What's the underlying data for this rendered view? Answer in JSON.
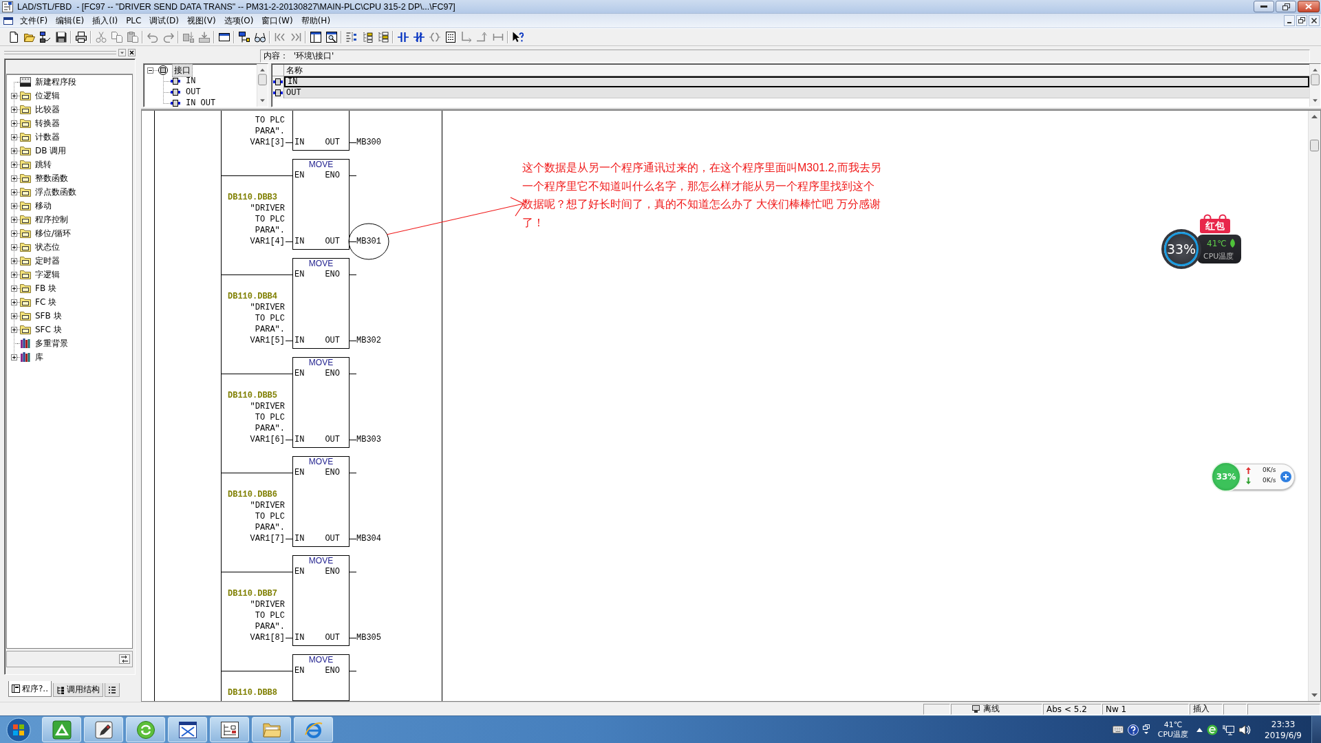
{
  "window": {
    "title": "LAD/STL/FBD  - [FC97 -- \"DRIVER SEND DATA TRANS\" -- PM31-2-20130827\\MAIN-PLC\\CPU 315-2 DP\\...\\FC97]"
  },
  "menu": [
    "文件(F)",
    "编辑(E)",
    "插入(I)",
    "PLC",
    "调试(D)",
    "视图(V)",
    "选项(O)",
    "窗口(W)",
    "帮助(H)"
  ],
  "toolbar": {
    "groups": [
      {
        "buttons": [
          {
            "disabled": false
          },
          {
            "disabled": false
          },
          {
            "disabled": false
          },
          {
            "disabled": false
          }
        ]
      },
      {
        "buttons": [
          {
            "disabled": false
          }
        ]
      },
      {
        "buttons": [
          {
            "disabled": true
          },
          {
            "disabled": true
          },
          {
            "disabled": true
          }
        ]
      },
      {
        "buttons": [
          {
            "disabled": true
          },
          {
            "disabled": true
          }
        ]
      },
      {
        "buttons": [
          {
            "disabled": true
          },
          {
            "disabled": true
          }
        ]
      },
      {
        "buttons": [
          {
            "disabled": false
          }
        ]
      },
      {
        "buttons": [
          {
            "disabled": false
          },
          {
            "disabled": false
          }
        ]
      },
      {
        "buttons": [
          {
            "disabled": true
          },
          {
            "disabled": true
          }
        ]
      },
      {
        "buttons": [
          {
            "disabled": false
          },
          {
            "disabled": false
          }
        ]
      },
      {
        "buttons": [
          {
            "disabled": false
          },
          {
            "disabled": false
          },
          {
            "disabled": false
          }
        ]
      },
      {
        "buttons": [
          {
            "disabled": false
          },
          {
            "disabled": false
          },
          {
            "disabled": true
          },
          {
            "disabled": false
          },
          {
            "disabled": true
          },
          {
            "disabled": true
          },
          {
            "disabled": true
          }
        ]
      },
      {
        "buttons": [
          {
            "disabled": false
          }
        ]
      }
    ]
  },
  "catalog": {
    "items": [
      {
        "label": "新建程序段"
      },
      {
        "label": "位逻辑",
        "expanded": false
      },
      {
        "label": "比较器",
        "expanded": false
      },
      {
        "label": "转换器",
        "expanded": false
      },
      {
        "label": "计数器",
        "expanded": false
      },
      {
        "label": "DB 调用",
        "expanded": false
      },
      {
        "label": "跳转",
        "expanded": false
      },
      {
        "label": "整数函数",
        "expanded": false
      },
      {
        "label": "浮点数函数",
        "expanded": false
      },
      {
        "label": "移动",
        "expanded": false
      },
      {
        "label": "程序控制",
        "expanded": false
      },
      {
        "label": "移位/循环",
        "expanded": false
      },
      {
        "label": "状态位",
        "expanded": false
      },
      {
        "label": "定时器",
        "expanded": false
      },
      {
        "label": "字逻辑",
        "expanded": false
      },
      {
        "label": "FB 块",
        "expanded": false
      },
      {
        "label": "FC 块",
        "expanded": false
      },
      {
        "label": "SFB 块",
        "expanded": false
      },
      {
        "label": "SFC 块",
        "expanded": false
      },
      {
        "label": "多重背景"
      },
      {
        "label": "库",
        "expanded": false
      }
    ],
    "tabs": [
      {
        "label": "程序?..",
        "selected": true
      },
      {
        "label": "调用结构",
        "selected": false
      },
      {
        "selected": false
      }
    ]
  },
  "interface": {
    "content_label": "内容：  '环境\\接口'",
    "tree": {
      "label": "接口",
      "expanded": true,
      "selected": true,
      "children": [
        {
          "label": "IN",
          "selected": false
        },
        {
          "label": "OUT",
          "selected": false
        },
        {
          "label": "IN OUT",
          "selected": false
        }
      ]
    },
    "table": {
      "columns": [
        "名称"
      ],
      "rows": [
        {
          "name": "IN",
          "selected": true
        },
        {
          "name": "OUT",
          "selected": false
        }
      ]
    }
  },
  "ladder": {
    "rungs": [
      {
        "operand": [
          "TO PLC",
          "PARA″.",
          "VAR1[3]"
        ],
        "in_pin": "IN",
        "out_pin": "OUT",
        "output": "MB300",
        "circled": false
      },
      {
        "title": "MOVE",
        "en_pin": "EN",
        "eno_pin": "ENO",
        "address": "DB110.DBB3",
        "operand": [
          "″DRIVER",
          "TO PLC",
          "PARA″.",
          "VAR1[4]"
        ],
        "in_pin": "IN",
        "out_pin": "OUT",
        "output": "MB301",
        "circled": true
      },
      {
        "title": "MOVE",
        "en_pin": "EN",
        "eno_pin": "ENO",
        "address": "DB110.DBB4",
        "operand": [
          "″DRIVER",
          "TO PLC",
          "PARA″.",
          "VAR1[5]"
        ],
        "in_pin": "IN",
        "out_pin": "OUT",
        "output": "MB302",
        "circled": false
      },
      {
        "title": "MOVE",
        "en_pin": "EN",
        "eno_pin": "ENO",
        "address": "DB110.DBB5",
        "operand": [
          "″DRIVER",
          "TO PLC",
          "PARA″.",
          "VAR1[6]"
        ],
        "in_pin": "IN",
        "out_pin": "OUT",
        "output": "MB303",
        "circled": false
      },
      {
        "title": "MOVE",
        "en_pin": "EN",
        "eno_pin": "ENO",
        "address": "DB110.DBB6",
        "operand": [
          "″DRIVER",
          "TO PLC",
          "PARA″.",
          "VAR1[7]"
        ],
        "in_pin": "IN",
        "out_pin": "OUT",
        "output": "MB304",
        "circled": false
      },
      {
        "title": "MOVE",
        "en_pin": "EN",
        "eno_pin": "ENO",
        "address": "DB110.DBB7",
        "operand": [
          "″DRIVER",
          "TO PLC",
          "PARA″.",
          "VAR1[8]"
        ],
        "in_pin": "IN",
        "out_pin": "OUT",
        "output": "MB305",
        "circled": false
      },
      {
        "title": "MOVE",
        "en_pin": "EN",
        "eno_pin": "ENO",
        "address": "DB110.DBB8",
        "circled": false
      }
    ],
    "note": "这个数据是从另一个程序通讯过来的，在这个程序里面叫M301.2,而我去另一个程序里它不知道叫什么名字，那怎么样才能从另一个程序里找到这个数据呢？想了好长时间了，真的不知道怎么办了 大侠们棒棒忙吧 万分感谢了！"
  },
  "status_bar": {
    "mode": "离线",
    "address": "Abs < 5.2",
    "network": "Nw 1",
    "edit_mode": "插入"
  },
  "cpu_monitor": {
    "badge": "红包",
    "load": "33%",
    "temperature": "41℃",
    "label": "CPU温度"
  },
  "net_monitor": {
    "load": "33%",
    "upload": "0K/s",
    "download": "0K/s"
  },
  "taskbar": {
    "temperature": "41℃",
    "sensor": "CPU温度",
    "time": "23:33",
    "date": "2019/6/9"
  }
}
